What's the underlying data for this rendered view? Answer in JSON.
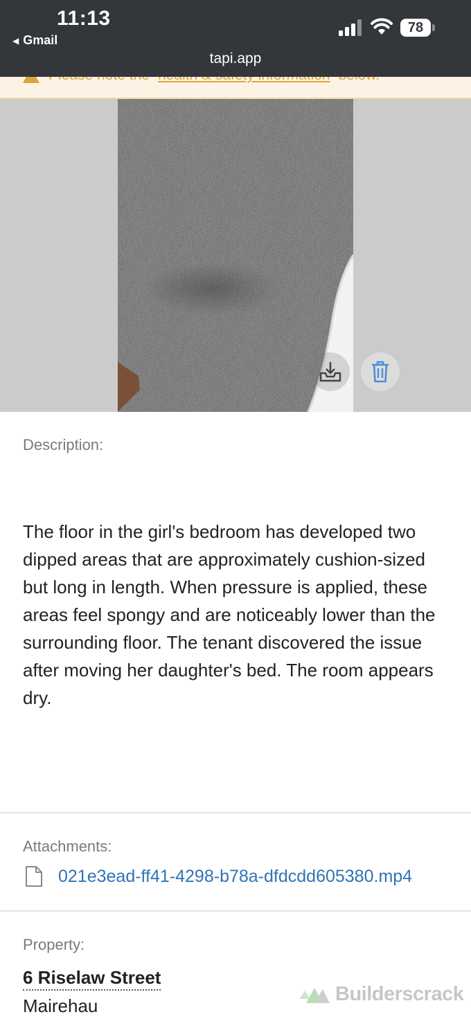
{
  "status_bar": {
    "time": "11:13",
    "back_label": "Gmail",
    "url": "tapi.app",
    "battery": "78"
  },
  "warning": {
    "prefix": "Please note the",
    "link": "health & safety information",
    "suffix": "below."
  },
  "photo": {
    "download_icon": "download-tray-icon",
    "delete_icon": "trash-icon"
  },
  "description": {
    "label": "Description:",
    "text": "The floor in the girl's bedroom has developed two dipped areas that are approximately cushion-sized but long in length. When pressure is applied, these areas feel spongy and are noticeably lower than the surrounding floor. The tenant discovered the issue after moving her daughter's bed. The room appears dry."
  },
  "attachments": {
    "label": "Attachments:",
    "files": [
      {
        "name": "021e3ead-ff41-4298-b78a-dfdcdd605380.mp4",
        "icon": "file-icon"
      }
    ]
  },
  "property": {
    "label": "Property:",
    "street": "6 Riselaw Street",
    "suburb": "Mairehau"
  },
  "brand": {
    "name": "Builderscrack"
  },
  "colors": {
    "status_bar_bg": "#33363a",
    "warning_bg": "#fdf3e4",
    "warning_text": "#e0a33a",
    "link_blue": "#2f74b5",
    "delete_icon_blue": "#4a8fd6"
  }
}
